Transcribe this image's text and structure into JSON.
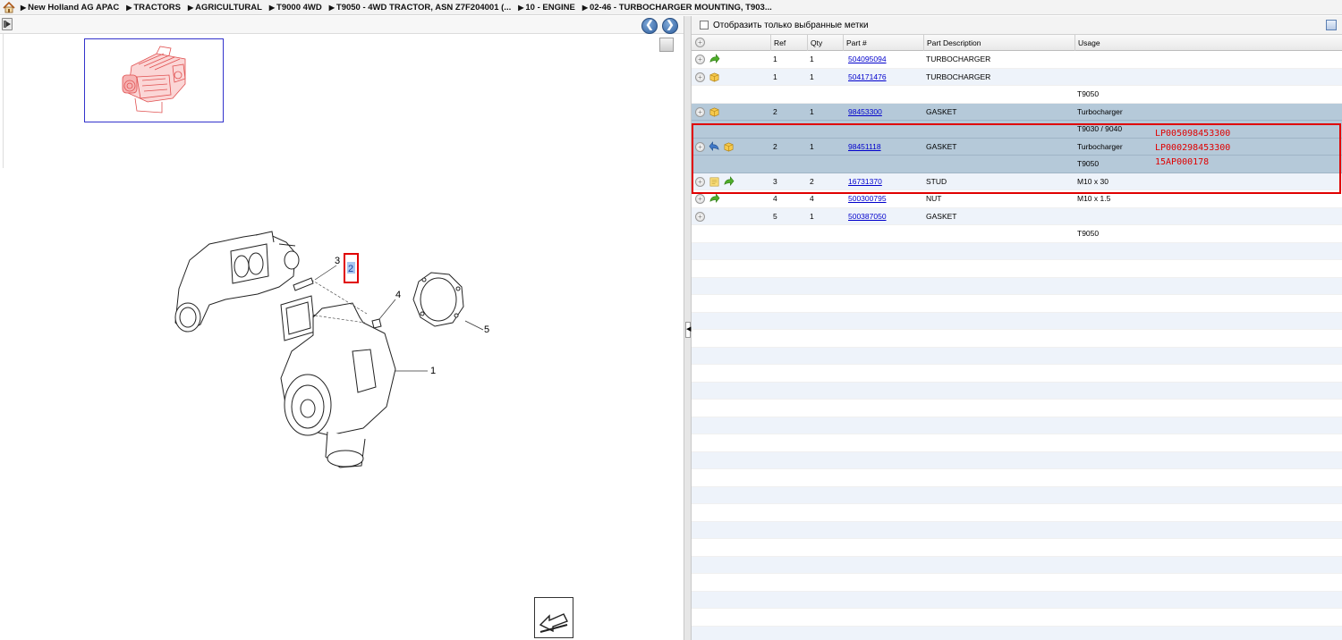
{
  "breadcrumb": {
    "items": [
      "New Holland AG APAC",
      "TRACTORS",
      "AGRICULTURAL",
      "T9000 4WD",
      "T9050 - 4WD TRACTOR, ASN Z7F204001 (...",
      "10 - ENGINE",
      "02-46 - TURBOCHARGER MOUNTING, T903..."
    ]
  },
  "filter": {
    "label": "Отобразить только выбранные метки"
  },
  "grid": {
    "columns": [
      "Ref",
      "Qty",
      "Part #",
      "Part Description",
      "Usage"
    ],
    "rows": [
      {
        "icons": [
          "arrow-green"
        ],
        "ref": "1",
        "qty": "1",
        "part": "504095094",
        "desc": "TURBOCHARGER",
        "usage": ""
      },
      {
        "icons": [
          "box-yellow"
        ],
        "ref": "1",
        "qty": "1",
        "part": "504171476",
        "desc": "TURBOCHARGER",
        "usage": ""
      },
      {
        "icons": [],
        "ref": "",
        "qty": "",
        "part": "",
        "desc": "",
        "usage": "T9050",
        "noplus": true
      },
      {
        "icons": [
          "box-yellow"
        ],
        "ref": "2",
        "qty": "1",
        "part": "98453300",
        "desc": "GASKET",
        "usage": "Turbocharger",
        "hl": true
      },
      {
        "icons": [],
        "ref": "",
        "qty": "",
        "part": "",
        "desc": "",
        "usage": "T9030 / 9040",
        "noplus": true,
        "hl": true
      },
      {
        "icons": [
          "arrow-blue",
          "box-yellow"
        ],
        "ref": "2",
        "qty": "1",
        "part": "98451118",
        "desc": "GASKET",
        "usage": "Turbocharger",
        "hl": true
      },
      {
        "icons": [],
        "ref": "",
        "qty": "",
        "part": "",
        "desc": "",
        "usage": "T9050",
        "noplus": true,
        "hl": true
      },
      {
        "icons": [
          "note-yellow",
          "arrow-green"
        ],
        "ref": "3",
        "qty": "2",
        "part": "16731370",
        "desc": "STUD",
        "usage": "M10 x 30"
      },
      {
        "icons": [
          "arrow-green"
        ],
        "ref": "4",
        "qty": "4",
        "part": "500300795",
        "desc": "NUT",
        "usage": "M10 x 1.5"
      },
      {
        "icons": [],
        "ref": "5",
        "qty": "1",
        "part": "500387050",
        "desc": "GASKET",
        "usage": ""
      },
      {
        "icons": [],
        "ref": "",
        "qty": "",
        "part": "",
        "desc": "",
        "usage": "T9050",
        "noplus": true
      }
    ]
  },
  "annotations": [
    "LP005098453300",
    "LP000298453300",
    "15AP000178"
  ],
  "diagram": {
    "callouts": [
      "1",
      "2",
      "3",
      "4",
      "5"
    ]
  },
  "colors": {
    "highlight": "#e00000",
    "row_highlight": "#b5c9d9",
    "row_alt": "#eef3fa",
    "link": "#0000cc"
  }
}
